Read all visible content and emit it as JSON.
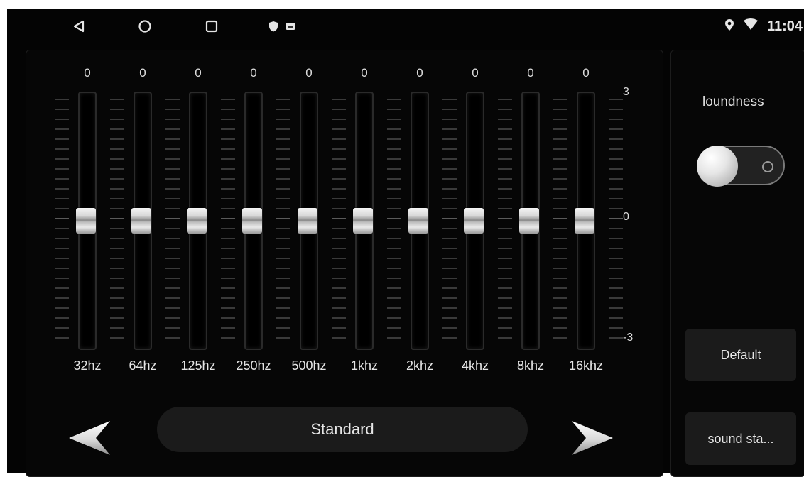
{
  "status_bar": {
    "nav": {
      "back_icon": "triangle-back-icon",
      "home_icon": "circle-home-icon",
      "recents_icon": "square-recents-icon"
    },
    "notifications": [
      "shield-icon",
      "image-icon"
    ],
    "indicators": [
      "location-pin-icon",
      "wifi-icon"
    ],
    "time": "11:04"
  },
  "equalizer": {
    "bands": [
      {
        "freq": "32hz",
        "gain": "0"
      },
      {
        "freq": "64hz",
        "gain": "0"
      },
      {
        "freq": "125hz",
        "gain": "0"
      },
      {
        "freq": "250hz",
        "gain": "0"
      },
      {
        "freq": "500hz",
        "gain": "0"
      },
      {
        "freq": "1khz",
        "gain": "0"
      },
      {
        "freq": "2khz",
        "gain": "0"
      },
      {
        "freq": "4khz",
        "gain": "0"
      },
      {
        "freq": "8khz",
        "gain": "0"
      },
      {
        "freq": "16khz",
        "gain": "0"
      }
    ],
    "scale": {
      "max": "3",
      "mid": "0",
      "min": "-3"
    },
    "range": {
      "min": -3,
      "max": 3
    }
  },
  "preset": {
    "name": "Standard",
    "prev_icon": "arrow-left-icon",
    "next_icon": "arrow-right-icon"
  },
  "side_panel": {
    "loudness_label": "loundness",
    "loudness_on": false,
    "default_label": "Default",
    "sound_stage_label": "sound sta..."
  }
}
